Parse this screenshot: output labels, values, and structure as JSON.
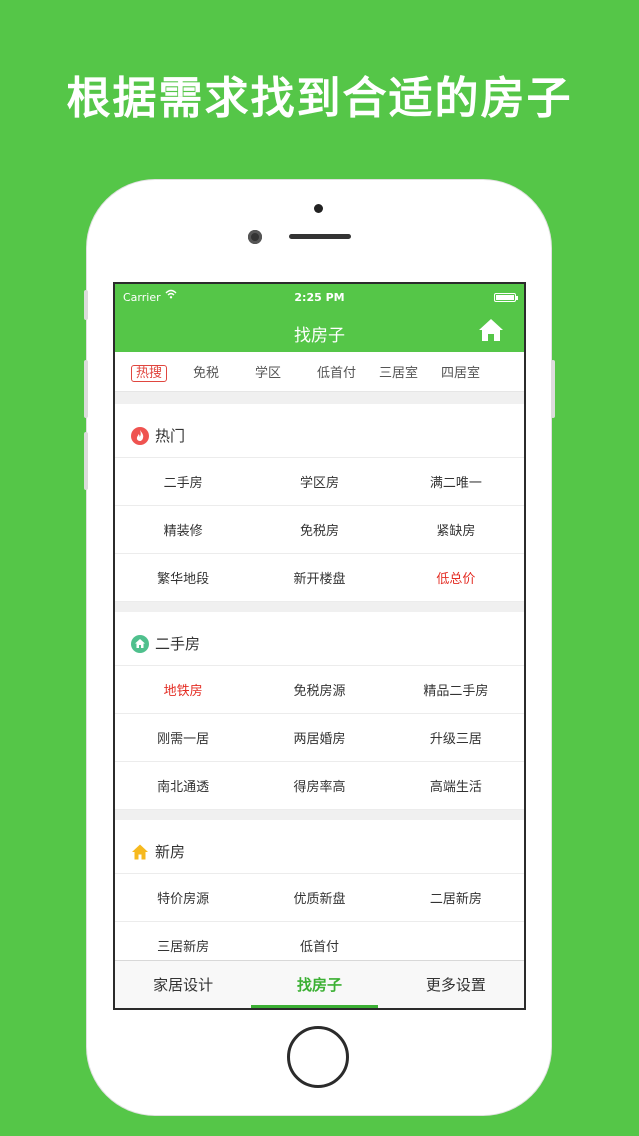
{
  "headline": "根据需求找到合适的房子",
  "colors": {
    "brand": "#55c648",
    "accent_red": "#e42e25",
    "tab_active": "#3cb034"
  },
  "status_bar": {
    "carrier": "Carrier",
    "wifi_icon": "wifi-icon",
    "time": "2:25 PM",
    "battery_level": 1.0
  },
  "navbar": {
    "title": "找房子",
    "home_icon": "home-icon"
  },
  "tabs": [
    "热搜",
    "免税",
    "学区",
    "低首付",
    "三居室",
    "四居室"
  ],
  "sections": [
    {
      "title": "热门",
      "icon": "fire-icon",
      "rows": [
        [
          "二手房",
          "学区房",
          "满二唯一"
        ],
        [
          "精装修",
          "免税房",
          "紧缺房"
        ],
        [
          "繁华地段",
          "新开楼盘",
          "低总价"
        ]
      ]
    },
    {
      "title": "二手房",
      "icon": "house-badge-icon",
      "rows": [
        [
          "地铁房",
          "免税房源",
          "精品二手房"
        ],
        [
          "刚需一居",
          "两居婚房",
          "升级三居"
        ],
        [
          "南北通透",
          "得房率高",
          "高端生活"
        ]
      ]
    },
    {
      "title": "新房",
      "icon": "house-icon",
      "rows": [
        [
          "特价房源",
          "优质新盘",
          "二居新房"
        ],
        [
          "三居新房",
          "低首付",
          ""
        ]
      ]
    }
  ],
  "tabbar": [
    "家居设计",
    "找房子",
    "更多设置"
  ]
}
